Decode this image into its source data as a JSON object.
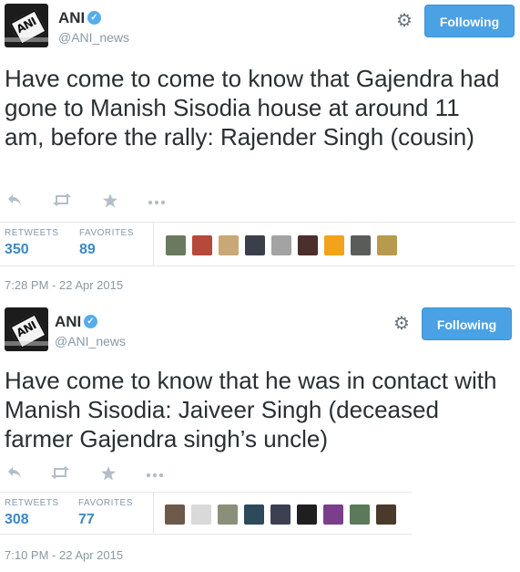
{
  "tweets": [
    {
      "name": "ANI",
      "handle": "@ANI_news",
      "follow_label": "Following",
      "text": "Have come to come to know that Gajendra had gone to Manish Sisodia house at around 11 am, before the rally: Rajender Singh (cousin)",
      "retweets_label": "RETWEETS",
      "retweets": "350",
      "favorites_label": "FAVORITES",
      "favorites": "89",
      "timestamp": "7:28 PM - 22 Apr 2015",
      "avatar_text": "ANI"
    },
    {
      "name": "ANI",
      "handle": "@ANI_news",
      "follow_label": "Following",
      "text": "Have come to know that he was in contact with Manish Sisodia: Jaiveer Singh (deceased farmer Gajendra singh’s uncle)",
      "retweets_label": "RETWEETS",
      "retweets": "308",
      "favorites_label": "FAVORITES",
      "favorites": "77",
      "timestamp": "7:10 PM - 22 Apr 2015",
      "avatar_text": "ANI"
    }
  ],
  "colors": {
    "follow_button": "#4aa2e4",
    "stat_value": "#3b88c3",
    "verified": "#55acee",
    "muted": "#8899a6"
  },
  "icons": [
    "reply-icon",
    "retweet-icon",
    "favorite-icon",
    "more-icon",
    "gear-icon",
    "verified-badge-icon"
  ]
}
